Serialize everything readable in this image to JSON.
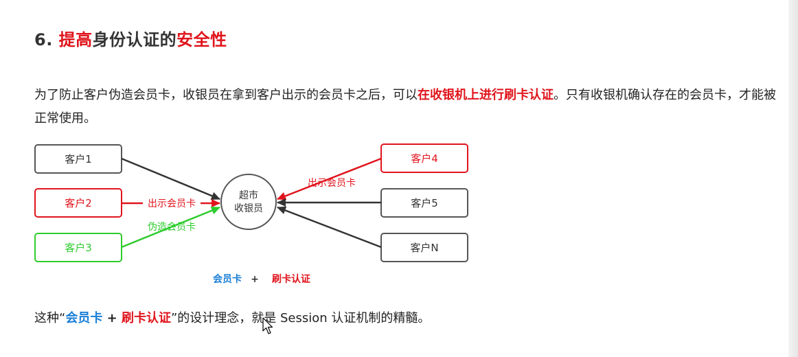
{
  "heading": {
    "number": "6. ",
    "part1": "提高",
    "part2": "身份认证的",
    "part3": "安全性"
  },
  "paragraph": {
    "text1": "为了防止客户伪造会员卡，收银员在拿到客户出示的会员卡之后，可以",
    "emphasis": "在收银机上进行刷卡认证",
    "text2": "。只有收银机确认存在的会员卡，才能被正常使用。"
  },
  "diagram": {
    "nodes": {
      "c1": "客户1",
      "c2": "客户2",
      "c3": "客户3",
      "c4": "客户4",
      "c5": "客户5",
      "cn": "客户N"
    },
    "center_line1": "超市",
    "center_line2": "收银员",
    "arrow_label_show_left": "出示会员卡",
    "arrow_label_forge": "伪造会员卡",
    "arrow_label_show_right": "出示会员卡",
    "caption_card": "会员卡",
    "caption_plus": "+",
    "caption_auth": "刷卡认证"
  },
  "conclusion": {
    "prefix": "这种“",
    "card": "会员卡",
    "plus": " + ",
    "auth": "刷卡认证",
    "suffix": "”的设计理念，就是 Session 认证机制的精髓。"
  },
  "colors": {
    "red": "#e0141c",
    "green": "#2ecc2e",
    "blue": "#1a7fd6",
    "gray": "#555555"
  }
}
